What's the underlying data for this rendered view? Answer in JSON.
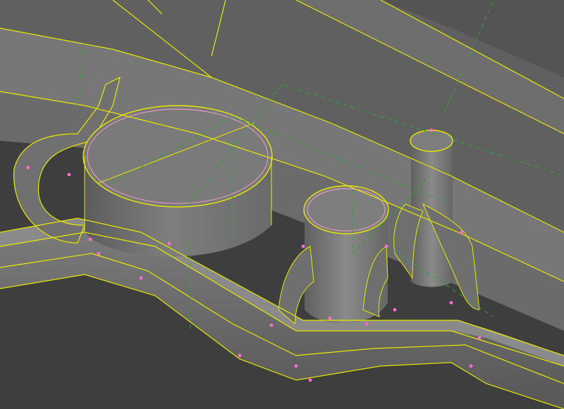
{
  "viewport": {
    "label": "",
    "background": "#3c3c3c"
  },
  "colors": {
    "edge": "#e8e800",
    "hidden_edge": "#2fa52f",
    "vertex": "#ff6ad5",
    "face_light": "#8a8a8a",
    "face_mid": "#767676",
    "face_dark": "#595959",
    "face_shadow": "#474747"
  },
  "features": [
    {
      "name": "large-cylindrical-boss",
      "kind": "cylinder"
    },
    {
      "name": "medium-cylindrical-boss",
      "kind": "cylinder"
    },
    {
      "name": "small-pin-boss",
      "kind": "cylinder"
    },
    {
      "name": "rib-channel",
      "kind": "groove"
    }
  ]
}
